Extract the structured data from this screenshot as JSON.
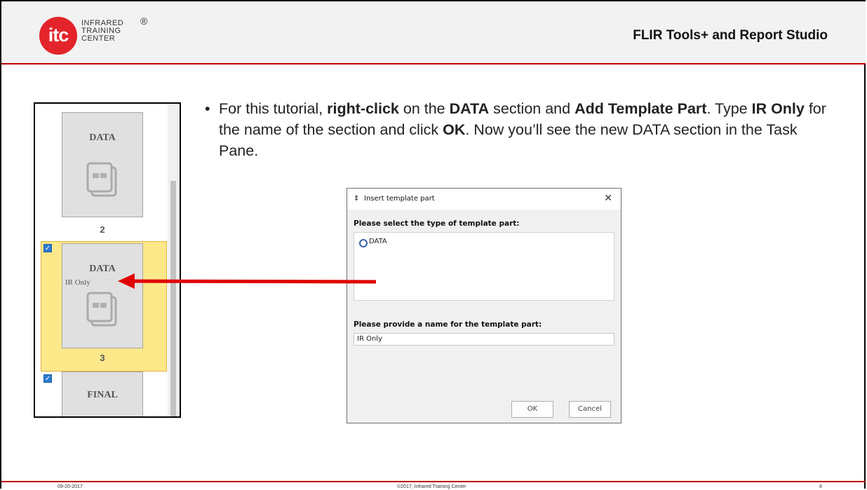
{
  "header": {
    "logo_mark": "itc",
    "logo_lines": [
      "INFRARED",
      "TRAINING",
      "CENTER"
    ],
    "logo_reg": "®",
    "title": "FLIR Tools+ and Report Studio"
  },
  "task_pane": {
    "cards": [
      {
        "title": "DATA",
        "subtitle": "",
        "page": "2",
        "checked": false
      },
      {
        "title": "DATA",
        "subtitle": "IR Only",
        "page": "3",
        "checked": true,
        "selected": true
      },
      {
        "title": "FINAL",
        "subtitle": "",
        "page": "",
        "checked": true
      }
    ],
    "checkmark": "✓"
  },
  "bullet": {
    "dot": "•",
    "parts": [
      {
        "text": "For this tutorial, ",
        "bold": false
      },
      {
        "text": "right-click",
        "bold": true
      },
      {
        "text": " on the ",
        "bold": false
      },
      {
        "text": "DATA",
        "bold": true
      },
      {
        "text": " section and ",
        "bold": false
      },
      {
        "text": "Add Template Part",
        "bold": true
      },
      {
        "text": ".  Type ",
        "bold": false
      },
      {
        "text": "IR Only",
        "bold": true
      },
      {
        "text": " for the name of the section and click ",
        "bold": false
      },
      {
        "text": "OK",
        "bold": true
      },
      {
        "text": ".  Now you’ll see the new DATA section in the Task Pane.",
        "bold": false
      }
    ]
  },
  "dialog": {
    "icon": "⇕",
    "title": "Insert template part",
    "close": "✕",
    "type_label": "Please select the type of template part:",
    "type_option": "DATA",
    "name_label": "Please provide a name for the template part:",
    "name_value": "IR Only",
    "ok_label": "OK",
    "cancel_label": "Cancel"
  },
  "colors": {
    "accent_red": "#c00000",
    "arrow_red": "#e00000",
    "selected_yellow": "#fde88a",
    "checkbox_blue": "#2e7bd3"
  },
  "footer": {
    "date": "09-20-2017",
    "copyright": "©2017, Infrared Training Center",
    "page": "8"
  }
}
